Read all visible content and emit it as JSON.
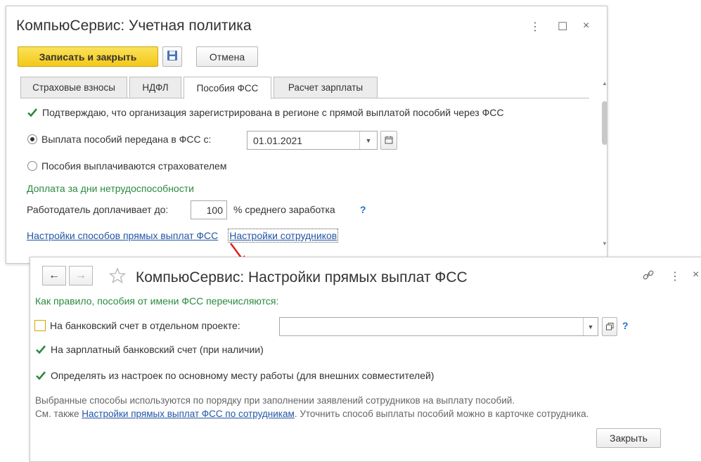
{
  "window1": {
    "title": "КомпьюСервис: Учетная политика",
    "controls": {
      "more": "⋮",
      "maximize": "☐",
      "close": "×"
    },
    "toolbar": {
      "save_close_label": "Записать и закрыть",
      "cancel_label": "Отмена"
    },
    "tabs": [
      {
        "label": "Страховые взносы"
      },
      {
        "label": "НДФЛ"
      },
      {
        "label": "Пособия ФСС"
      },
      {
        "label": "Расчет зарплаты"
      }
    ],
    "confirm_checkbox_label": "Подтверждаю, что организация зарегистрирована в регионе с прямой выплатой пособий через ФСС",
    "radio_transferred_label": "Выплата пособий передана в ФСС с:",
    "date_value": "01.01.2021",
    "radio_insurer_label": "Пособия выплачиваются страхователем",
    "section_title": "Доплата за дни нетрудоспособности",
    "employer_label": "Работодатель доплачивает до:",
    "percent_value": "100",
    "percent_suffix": "% среднего заработка",
    "help": "?",
    "link_payment_methods": "Настройки способов прямых выплат ФСС",
    "link_employees": "Настройки сотрудников"
  },
  "window2": {
    "nav_back": "←",
    "nav_forward": "→",
    "title": "КомпьюСервис: Настройки прямых выплат ФСС",
    "subtitle": "Как правило, пособия от имени ФСС перечисляются:",
    "option_bank_project": "На банковский счет в отдельном проекте:",
    "bank_project_value": "",
    "option_salary_account": "На зарплатный банковский счет (при наличии)",
    "option_main_job": "Определять из настроек по основному месту работы (для внешних совместителей)",
    "help": "?",
    "note_line1": "Выбранные способы используются по порядку при заполнении заявлений сотрудников на выплату пособий.",
    "note_see_also": "См. также ",
    "note_link": "Настройки прямых выплат ФСС по сотрудникам",
    "note_tail": ". Уточнить способ выплаты пособий можно в карточке сотрудника.",
    "close_button": "Закрыть",
    "controls": {
      "more": "⋮",
      "close": "×"
    }
  },
  "checked": {
    "confirm": true,
    "bank_project": false,
    "salary_account": true,
    "main_job": true
  },
  "colors": {
    "accent_green": "#2b8a3e",
    "link_blue": "#2255a4",
    "primary_yellow": "#f5d02a",
    "arrow_red": "#e02020"
  }
}
